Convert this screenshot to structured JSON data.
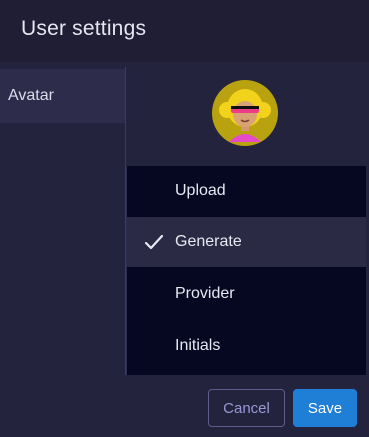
{
  "header": {
    "title": "User settings"
  },
  "sidebar": {
    "items": [
      {
        "label": "Avatar"
      }
    ]
  },
  "avatar": {
    "icon": "avatar-icon"
  },
  "menu": {
    "items": [
      {
        "label": "Upload",
        "selected": false
      },
      {
        "label": "Generate",
        "selected": true
      },
      {
        "label": "Provider",
        "selected": false
      },
      {
        "label": "Initials",
        "selected": false
      }
    ]
  },
  "footer": {
    "cancel_label": "Cancel",
    "save_label": "Save"
  },
  "colors": {
    "accent": "#1f7fd6",
    "cancel_text": "#9a97d6",
    "menu_bg": "#060821"
  }
}
